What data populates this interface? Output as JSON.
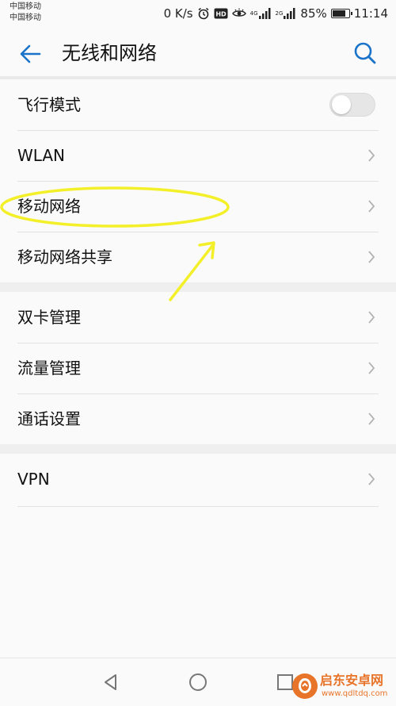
{
  "status_bar": {
    "carrier_1": "中国移动",
    "carrier_2": "中国移动",
    "net_speed": "0 K/s",
    "sim1_network": "4G",
    "sim2_network": "2G",
    "battery_percent": "85%",
    "battery_level": 0.85,
    "time": "11:14"
  },
  "app_bar": {
    "title": "无线和网络",
    "back_icon": "back-arrow-icon",
    "search_icon": "search-icon"
  },
  "groups": [
    {
      "items": [
        {
          "label": "飞行模式",
          "control": "toggle",
          "on": false
        },
        {
          "label": "WLAN",
          "control": "chevron"
        },
        {
          "label": "移动网络",
          "control": "chevron",
          "highlighted": true
        },
        {
          "label": "移动网络共享",
          "control": "chevron"
        }
      ]
    },
    {
      "items": [
        {
          "label": "双卡管理",
          "control": "chevron"
        },
        {
          "label": "流量管理",
          "control": "chevron"
        },
        {
          "label": "通话设置",
          "control": "chevron"
        }
      ]
    },
    {
      "items": [
        {
          "label": "VPN",
          "control": "chevron"
        }
      ]
    }
  ],
  "nav_bar": {
    "back": "nav-back-icon",
    "home": "nav-home-icon",
    "recents": "nav-recents-icon"
  },
  "watermark": {
    "name": "启东安卓网",
    "url": "www.qdltdq.com"
  },
  "colors": {
    "accent": "#1a73c9",
    "annotation": "#f3f02a",
    "watermark": "#e8742a"
  }
}
